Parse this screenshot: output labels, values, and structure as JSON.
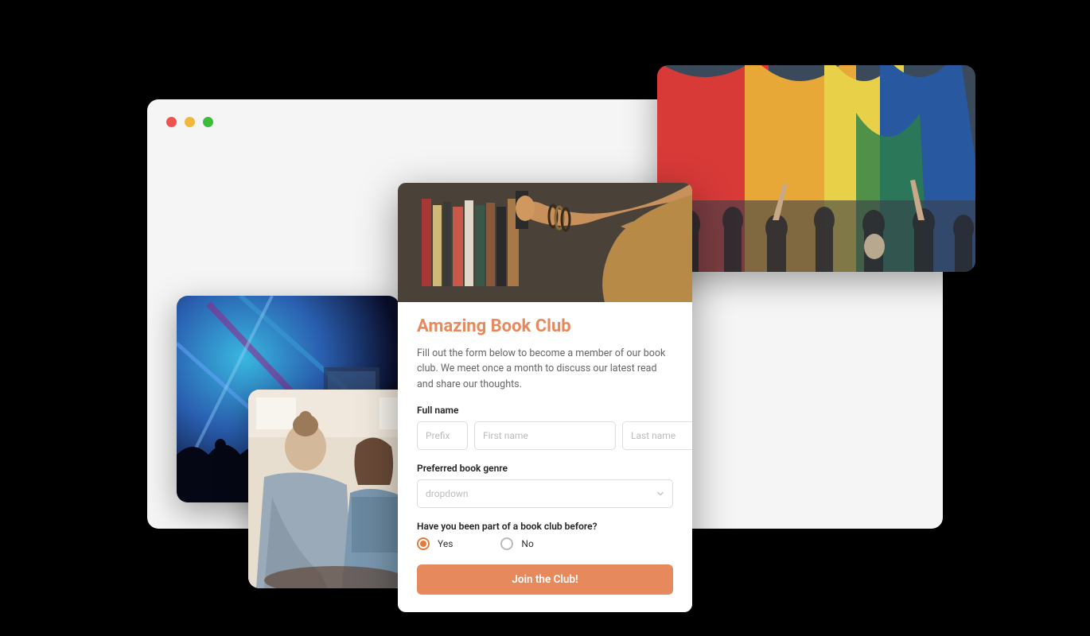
{
  "form": {
    "title": "Amazing Book Club",
    "description": "Fill out the form below to become a member of our book club. We meet once a month to discuss our latest read and share our thoughts.",
    "full_name_label": "Full name",
    "prefix_placeholder": "Prefix",
    "first_name_placeholder": "First name",
    "last_name_placeholder": "Last name",
    "genre_label": "Preferred book genre",
    "genre_placeholder": "dropdown",
    "prior_label": "Have you been part of a book club before?",
    "option_yes": "Yes",
    "option_no": "No",
    "selected_option": "yes",
    "submit_label": "Join the Club!"
  },
  "colors": {
    "accent": "#e68a5d",
    "accent_dark": "#e37b3e"
  }
}
